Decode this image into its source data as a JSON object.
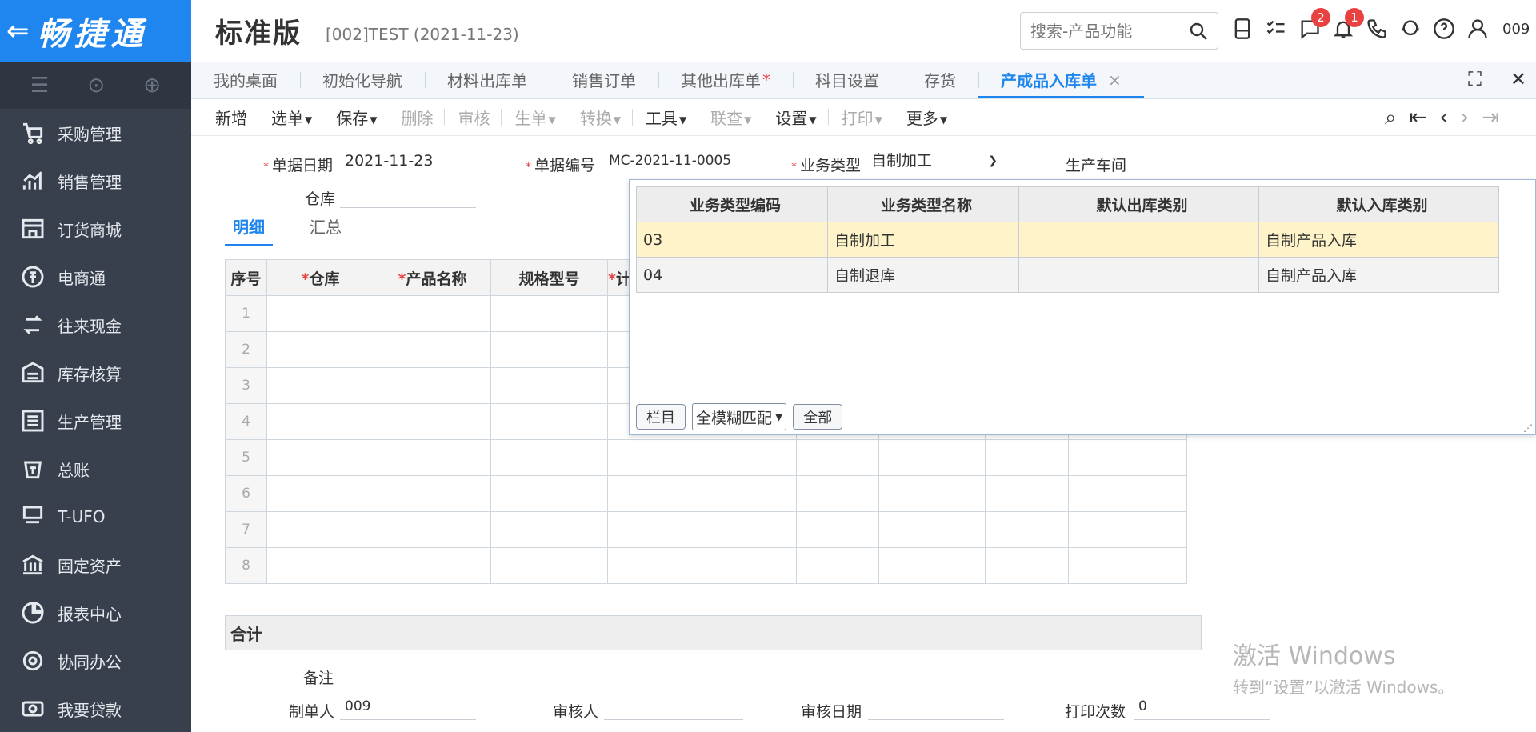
{
  "app": {
    "logo_back": "⇐",
    "brand": "畅捷通",
    "title": "标准版",
    "subtitle": "[002]TEST (2021-11-23)",
    "search_placeholder": "搜索-产品功能",
    "user": "009",
    "badges": {
      "messages": "2",
      "notifications": "1"
    }
  },
  "sidebar": {
    "items": [
      {
        "label": "采购管理",
        "icon": "cart-icon"
      },
      {
        "label": "销售管理",
        "icon": "chart-icon"
      },
      {
        "label": "订货商城",
        "icon": "store-icon"
      },
      {
        "label": "电商通",
        "icon": "ecommerce-icon"
      },
      {
        "label": "往来现金",
        "icon": "cash-icon"
      },
      {
        "label": "库存核算",
        "icon": "inventory-icon"
      },
      {
        "label": "生产管理",
        "icon": "production-icon"
      },
      {
        "label": "总账",
        "icon": "ledger-icon"
      },
      {
        "label": "T-UFO",
        "icon": "ufo-icon"
      },
      {
        "label": "固定资产",
        "icon": "bank-icon"
      },
      {
        "label": "报表中心",
        "icon": "pie-icon"
      },
      {
        "label": "协同办公",
        "icon": "collab-icon"
      },
      {
        "label": "我要贷款",
        "icon": "loan-icon"
      }
    ]
  },
  "tabs": [
    {
      "label": "我的桌面"
    },
    {
      "label": "初始化导航"
    },
    {
      "label": "材料出库单"
    },
    {
      "label": "销售订单"
    },
    {
      "label": "其他出库单",
      "mark": "*"
    },
    {
      "label": "科目设置"
    },
    {
      "label": "存货"
    },
    {
      "label": "产成品入库单",
      "close": "×"
    }
  ],
  "toolbar": {
    "new": "新增",
    "select": "选单",
    "save": "保存",
    "delete": "删除",
    "audit": "审核",
    "generate": "生单",
    "convert": "转换",
    "tools": "工具",
    "link": "联查",
    "settings": "设置",
    "print": "打印",
    "more": "更多"
  },
  "form": {
    "date_label": "单据日期",
    "date_value": "2021-11-23",
    "code_label": "单据编号",
    "code_value": "MC-2021-11-0005",
    "biz_label": "业务类型",
    "biz_value": "自制加工",
    "workshop_label": "生产车间",
    "warehouse_label": "仓库",
    "subtab_detail": "明细",
    "subtab_summary": "汇总",
    "total_label": "合计",
    "remark_label": "备注",
    "maker_label": "制单人",
    "maker_value": "009",
    "auditor_label": "审核人",
    "audit_date_label": "审核日期",
    "print_count_label": "打印次数",
    "print_count_value": "0"
  },
  "grid": {
    "headers": [
      "序号",
      "仓库",
      "产品名称",
      "规格型号",
      "计"
    ],
    "required": [
      false,
      true,
      true,
      false,
      true
    ],
    "rows": [
      "1",
      "2",
      "3",
      "4",
      "5",
      "6",
      "7",
      "8"
    ]
  },
  "popup": {
    "headers": [
      "业务类型编码",
      "业务类型名称",
      "默认出库类别",
      "默认入库类别"
    ],
    "rows": [
      {
        "code": "03",
        "name": "自制加工",
        "out": "",
        "in": "自制产品入库"
      },
      {
        "code": "04",
        "name": "自制退库",
        "out": "",
        "in": "自制产品入库"
      }
    ],
    "btn_columns": "栏目",
    "match_mode": "全模糊匹配",
    "btn_all": "全部"
  },
  "watermark": {
    "line1": "激活 Windows",
    "line2": "转到“设置”以激活 Windows。"
  }
}
